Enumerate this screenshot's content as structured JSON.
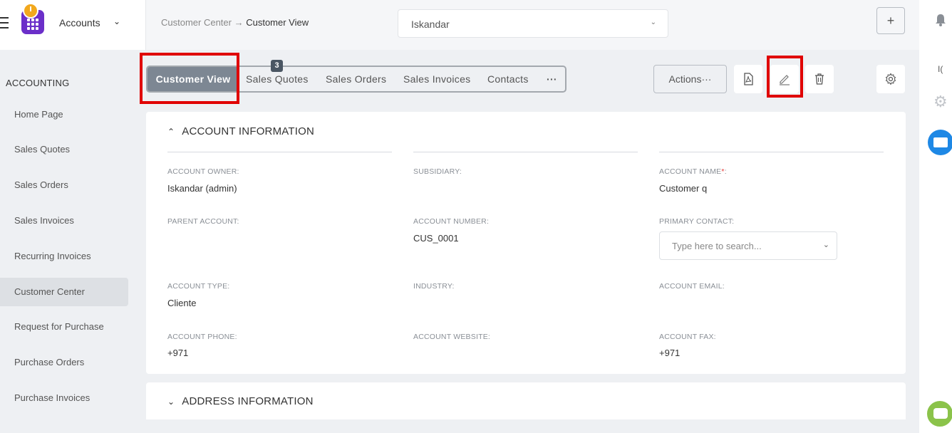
{
  "brand": {
    "title": "Accounts"
  },
  "breadcrumb": {
    "parent": "Customer Center",
    "separator": " → ",
    "current": "Customer View"
  },
  "customer_select": {
    "value": "Iskandar"
  },
  "sidebar": {
    "section": "ACCOUNTING",
    "items": [
      {
        "label": "Home Page"
      },
      {
        "label": "Sales Quotes"
      },
      {
        "label": "Sales Orders"
      },
      {
        "label": "Sales Invoices"
      },
      {
        "label": "Recurring Invoices"
      },
      {
        "label": "Customer Center",
        "active": true
      },
      {
        "label": "Request for Purchase"
      },
      {
        "label": "Purchase Orders"
      },
      {
        "label": "Purchase Invoices"
      }
    ]
  },
  "tabs": [
    {
      "label": "Customer View",
      "active": true
    },
    {
      "label": "Sales Quotes",
      "badge": "3"
    },
    {
      "label": "Sales Orders"
    },
    {
      "label": "Sales Invoices"
    },
    {
      "label": "Contacts"
    },
    {
      "label": "···"
    }
  ],
  "toolbar": {
    "actions_label": "Actions···"
  },
  "account_info": {
    "title": "ACCOUNT INFORMATION",
    "fields": {
      "owner": {
        "label": "ACCOUNT OWNER:",
        "value": "Iskandar (admin)"
      },
      "subsidiary": {
        "label": "SUBSIDIARY:",
        "value": ""
      },
      "name": {
        "label": "ACCOUNT NAME",
        "required": "*",
        "suffix": ":",
        "value": "Customer q"
      },
      "parent": {
        "label": "PARENT ACCOUNT:",
        "value": ""
      },
      "number": {
        "label": "ACCOUNT NUMBER:",
        "value": "CUS_0001"
      },
      "primary_contact": {
        "label": "PRIMARY CONTACT:",
        "placeholder": "Type here to search..."
      },
      "type": {
        "label": "ACCOUNT TYPE:",
        "value": "Cliente"
      },
      "industry": {
        "label": "INDUSTRY:",
        "value": ""
      },
      "email": {
        "label": "ACCOUNT EMAIL:",
        "value": ""
      },
      "phone": {
        "label": "ACCOUNT PHONE:",
        "value": "+971"
      },
      "website": {
        "label": "ACCOUNT WEBSITE:",
        "value": ""
      },
      "fax": {
        "label": "ACCOUNT FAX:",
        "value": "+971"
      }
    }
  },
  "address_info": {
    "title": "ADDRESS INFORMATION"
  },
  "right_rail": {
    "toggle_text": "I("
  },
  "colors": {
    "highlight": "#e00000",
    "active_tab": "#7d8793",
    "mail": "#1e88e5",
    "chat": "#8bc34a",
    "brand": "#6b2fc9",
    "required": "#e53935"
  }
}
